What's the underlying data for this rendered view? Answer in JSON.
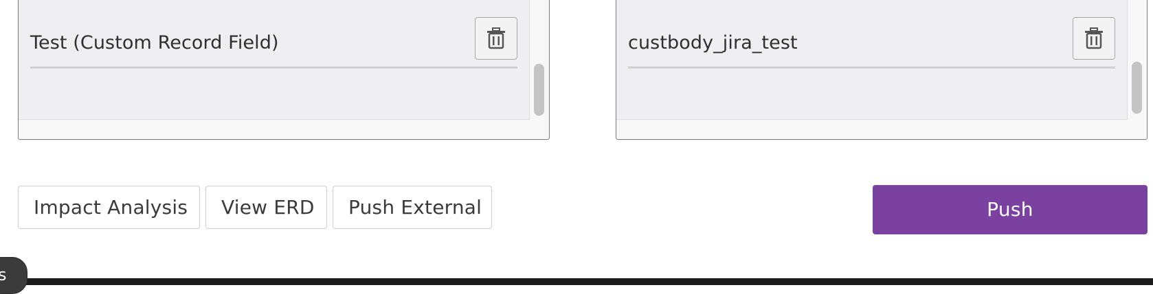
{
  "left_panel": {
    "rows": [
      {
        "label": ""
      },
      {
        "label": "Test (Custom Record Field)"
      }
    ]
  },
  "right_panel": {
    "rows": [
      {
        "label": ""
      },
      {
        "label": "custbody_jira_test"
      }
    ]
  },
  "actions": {
    "impact_analysis_label": "Impact Analysis",
    "view_erd_label": "View ERD",
    "push_external_label": "Push External",
    "push_label": "Push"
  },
  "bottom": {
    "pill_text": "s"
  },
  "colors": {
    "primary": "#7a41a1",
    "panel_bg": "#efeff1",
    "border": "#7a7a7a"
  },
  "icons": {
    "delete": "trash-icon"
  }
}
